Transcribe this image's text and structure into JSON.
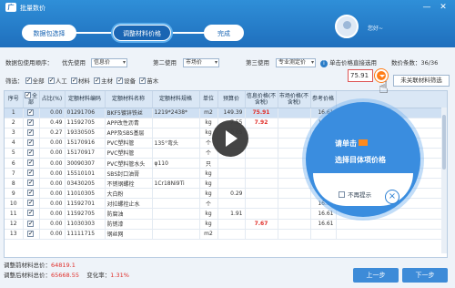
{
  "window": {
    "title": "批量数价",
    "logo": "广",
    "controls": [
      "—",
      "✕"
    ]
  },
  "steps": [
    "数据包选择",
    "调整材料价格",
    "完成"
  ],
  "user": {
    "name": "您好~"
  },
  "filter": {
    "price_order_label": "数据包使用顺序：",
    "first_label": "优先使用",
    "first_value": "信息价",
    "second_label": "第二使用",
    "second_value": "市场价",
    "third_label": "第三使用",
    "third_value": "专业测定价",
    "tip": "单击价格直接选用",
    "count_label": "数价条数：",
    "count_value": "36/36"
  },
  "filter2": {
    "label": "筛选：",
    "items": [
      "全部",
      "人工",
      "材料",
      "主材",
      "设备",
      "苗木"
    ]
  },
  "price_input": "75.91",
  "sync_button": "未关联材料筛选",
  "table": {
    "headers": [
      "序号",
      "全部",
      "占比(%)",
      "定额材料编码",
      "定额材料名称",
      "定额材料规格",
      "单位",
      "预算价",
      "信息价格(不含税)",
      "市场价格(不含税)",
      "参考价格"
    ],
    "rows": [
      [
        "1",
        "",
        "0.00",
        "01291706",
        "BKF5镀锌铁丝",
        "1219*2438*",
        "m2",
        "149.39",
        "75.91",
        "",
        "16.61"
      ],
      [
        "2",
        "",
        "0.49",
        "11592705",
        "APP改性沥青",
        "",
        "kg",
        "7.55",
        "7.92",
        "",
        "16.61"
      ],
      [
        "3",
        "",
        "0.27",
        "19330505",
        "APP及SBS基层",
        "",
        "kg",
        "10.05",
        "",
        "",
        "16.61"
      ],
      [
        "4",
        "",
        "0.00",
        "15170916",
        "PVC塑料管",
        "135°弯头",
        "个",
        "",
        "",
        "",
        "16.61"
      ],
      [
        "5",
        "",
        "0.00",
        "15170917",
        "PVC塑料管",
        "",
        "个",
        "",
        "",
        "",
        "16.61"
      ],
      [
        "6",
        "",
        "0.00",
        "30090307",
        "PVC塑料管水头",
        "φ110",
        "只",
        "",
        "",
        "",
        "16.61"
      ],
      [
        "7",
        "",
        "0.00",
        "15510101",
        "SBS封口油膏",
        "",
        "kg",
        "",
        "",
        "",
        "16.61"
      ],
      [
        "8",
        "",
        "0.00",
        "03430205",
        "不锈钢螺栓",
        "1Cr18Ni9Ti",
        "kg",
        "",
        "",
        "",
        "16.61"
      ],
      [
        "9",
        "",
        "0.00",
        "11010305",
        "大白粉",
        "",
        "kg",
        "0.29",
        "",
        "",
        "16.61"
      ],
      [
        "10",
        "",
        "0.00",
        "11592701",
        "对拉螺栓止水",
        "",
        "个",
        "",
        "",
        "",
        "16.61"
      ],
      [
        "11",
        "",
        "0.00",
        "11592705",
        "防腐油",
        "",
        "kg",
        "1.91",
        "",
        "",
        "16.61"
      ],
      [
        "12",
        "",
        "0.00",
        "11030303",
        "防锈漆",
        "",
        "kg",
        "",
        "7.67",
        "",
        "16.61"
      ],
      [
        "13",
        "",
        "0.00",
        "11111715",
        "钢丝网",
        "",
        "m2",
        "",
        "",
        "",
        ""
      ]
    ]
  },
  "footer": {
    "before_label": "调整前材料总价：",
    "before_value": "64819.1",
    "after_label": "调整后材料总价：",
    "after_value": "65668.55",
    "change_label": "变化率：",
    "change_value": "1.31%"
  },
  "buttons": {
    "prev": "上一步",
    "next": "下一步"
  },
  "popup": {
    "line1": "请单击",
    "line2": "选择目体项价格",
    "nomore": "不再提示"
  }
}
